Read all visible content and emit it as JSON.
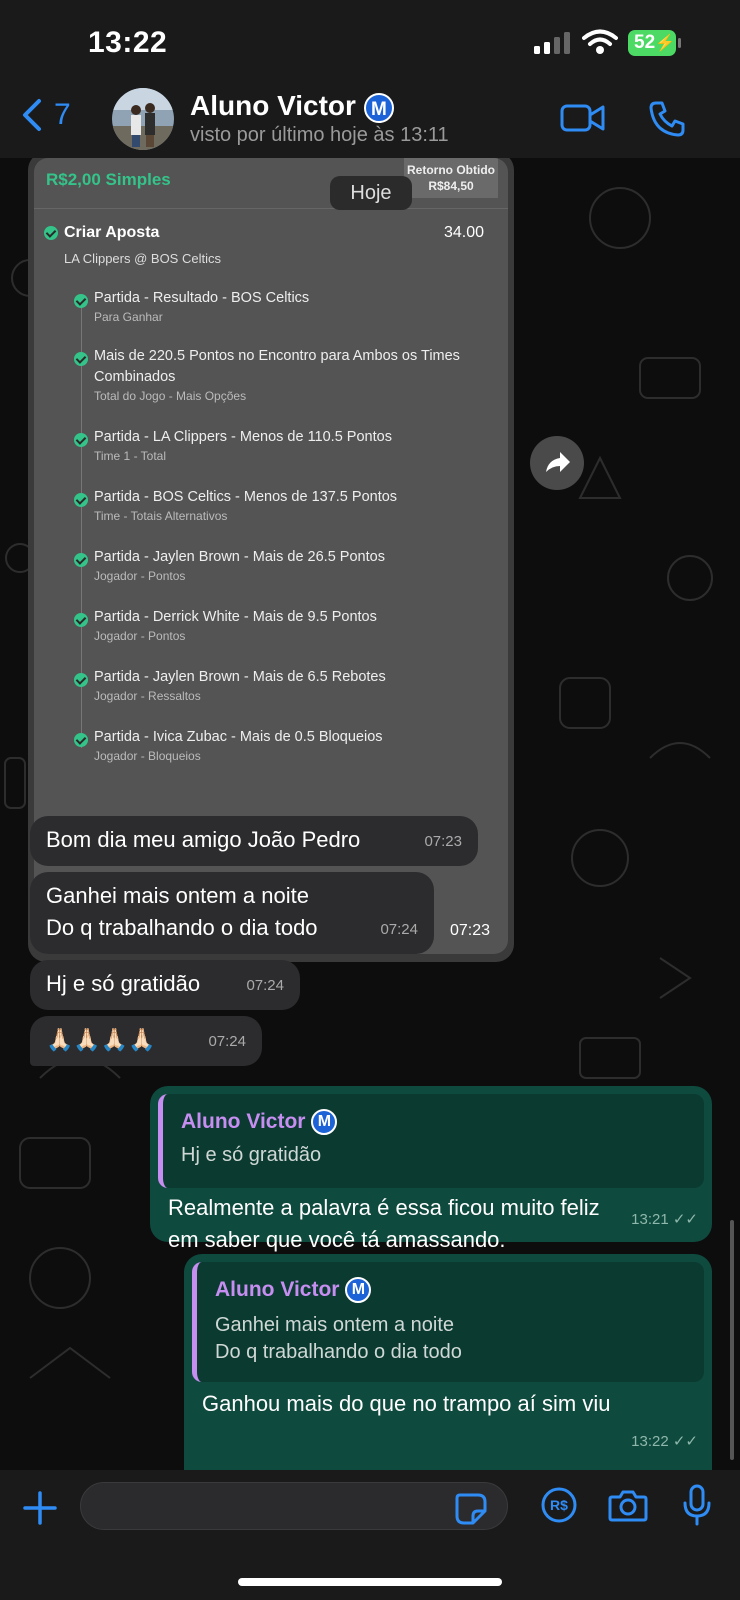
{
  "status_bar": {
    "time": "13:22",
    "battery": "52"
  },
  "header": {
    "back_count": "7",
    "contact_name": "Aluno Victor",
    "contact_badge": "M",
    "last_seen": "visto por último hoje às 13:11"
  },
  "date_chip": "Hoje",
  "bet_image": {
    "stake": "R$2,00 Simples",
    "return_label": "Retorno Obtido",
    "return_value": "R$84,50",
    "title": "Criar Aposta",
    "odds": "34.00",
    "match": "LA Clippers @ BOS Celtics",
    "legs": [
      {
        "title": "Partida - Resultado - BOS Celtics",
        "sub": "Para Ganhar"
      },
      {
        "title": "Mais de 220.5 Pontos no Encontro para Ambos os Times Combinados",
        "sub": "Total do Jogo - Mais Opções"
      },
      {
        "title": "Partida - LA Clippers - Menos de 110.5 Pontos",
        "sub": "Time 1 - Total"
      },
      {
        "title": "Partida - BOS Celtics - Menos de 137.5 Pontos",
        "sub": "Time - Totais Alternativos"
      },
      {
        "title": "Partida - Jaylen Brown - Mais de 26.5 Pontos",
        "sub": "Jogador - Pontos"
      },
      {
        "title": "Partida - Derrick White - Mais de 9.5 Pontos",
        "sub": "Jogador - Pontos"
      },
      {
        "title": "Partida - Jaylen Brown - Mais de 6.5 Rebotes",
        "sub": "Jogador - Ressaltos"
      },
      {
        "title": "Partida - Ivica Zubac - Mais de 0.5 Bloqueios",
        "sub": "Jogador - Bloqueios"
      }
    ],
    "time": "07:23"
  },
  "messages_in": [
    {
      "text": "Bom dia meu amigo João Pedro",
      "time": "07:23"
    },
    {
      "line1": "Ganhei mais ontem a noite",
      "line2": "Do q trabalhando o dia todo",
      "time": "07:24"
    },
    {
      "text": "Hj e só gratidão",
      "time": "07:24"
    },
    {
      "text": "🙏🏻🙏🏻🙏🏻🙏🏻",
      "time": "07:24"
    }
  ],
  "messages_out": [
    {
      "quote_name": "Aluno Victor",
      "quote_text": "Hj e só gratidão",
      "line1": "Realmente a palavra é essa ficou muito feliz",
      "line2": "em saber que você tá amassando.",
      "time": "13:21"
    },
    {
      "quote_name": "Aluno Victor",
      "quote_line1": "Ganhei mais ontem a noite",
      "quote_line2": "Do q trabalhando o dia todo",
      "text": "Ganhou mais do que no trampo aí sim viu",
      "time": "13:22"
    }
  ],
  "composer": {
    "placeholder": ""
  }
}
